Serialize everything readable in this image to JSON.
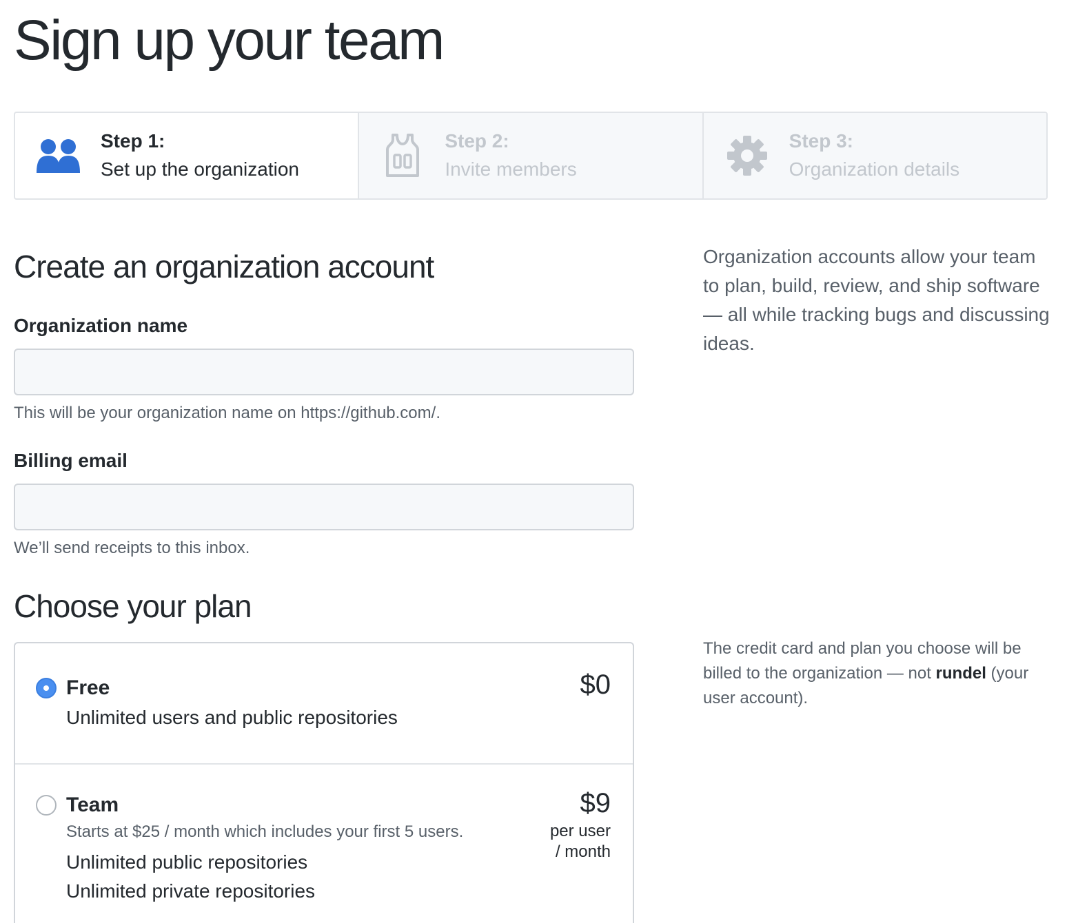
{
  "page": {
    "title": "Sign up your team"
  },
  "steps": [
    {
      "number": "Step 1:",
      "description": "Set up the organization",
      "icon": "people-icon",
      "state": "active"
    },
    {
      "number": "Step 2:",
      "description": "Invite members",
      "icon": "jersey-icon",
      "state": "inactive"
    },
    {
      "number": "Step 3:",
      "description": "Organization details",
      "icon": "gear-icon",
      "state": "inactive"
    }
  ],
  "account": {
    "heading": "Create an organization account",
    "org_name": {
      "label": "Organization name",
      "value": "",
      "placeholder": "",
      "note": "This will be your organization name on https://github.com/."
    },
    "billing_email": {
      "label": "Billing email",
      "value": "",
      "placeholder": "",
      "note": "We’ll send receipts to this inbox."
    },
    "about": "Organization accounts allow your team to plan, build, review, and ship software — all while tracking bugs and discussing ideas."
  },
  "plan": {
    "heading": "Choose your plan",
    "billing_note_prefix": "The credit card and plan you choose will be billed to the organization — not ",
    "billing_note_user": "rundel",
    "billing_note_suffix": " (your user account).",
    "options": [
      {
        "name": "Free",
        "selected": true,
        "price": "$0",
        "features": [
          "Unlimited users and public repositories"
        ]
      },
      {
        "name": "Team",
        "selected": false,
        "price": "$9",
        "price_unit_1": "per user",
        "price_unit_2": "/ month",
        "subtitle": "Starts at $25 / month which includes your first 5 users.",
        "features": [
          "Unlimited public repositories",
          "Unlimited private repositories"
        ]
      }
    ]
  },
  "colors": {
    "accent": "#0366d6",
    "radio_selected": "#4a8ff0",
    "inactive_text": "#c2c7cd",
    "muted_text": "#586069"
  }
}
